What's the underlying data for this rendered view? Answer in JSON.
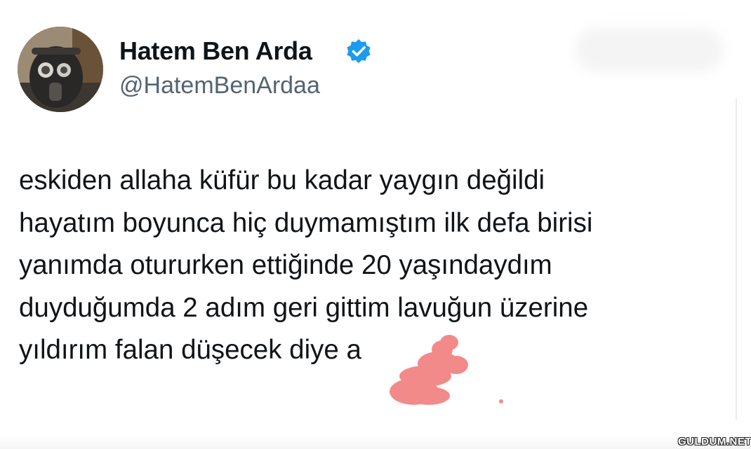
{
  "user": {
    "display_name": "Hatem Ben Arda",
    "handle": "@HatemBenArdaa",
    "verified": true,
    "verified_color": "#1d9bf0"
  },
  "tweet": {
    "lines": [
      "eskiden allaha küfür bu kadar yaygın değildi",
      "hayatım boyunca hiç duymamıştım ilk defa birisi",
      "yanımda otururken ettiğinde 20 yaşındaydım",
      "duyduğumda 2 adım geri gittim lavuğun üzerine",
      "yıldırım falan düşecek diye a"
    ]
  },
  "censor_mark": {
    "color": "#f28a8a"
  },
  "watermark": {
    "text": "GULDUM.NET"
  },
  "icons": [
    "avatar",
    "verified-badge-icon"
  ]
}
